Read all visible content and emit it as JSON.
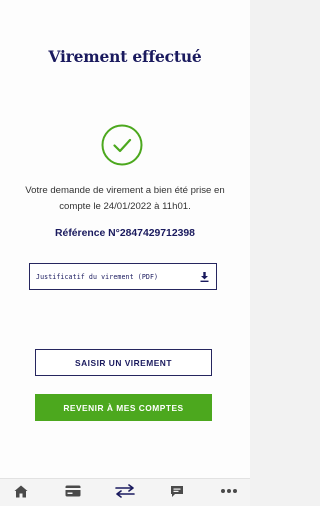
{
  "page": {
    "title": "Virement effectué",
    "message": "Votre demande de virement a bien été prise en compte le 24/01/2022 à 11h01.",
    "reference": "Référence N°2847429712398"
  },
  "download": {
    "label": "Justificatif du virement (PDF)",
    "icon": "download-icon"
  },
  "actions": {
    "new_transfer_label": "SAISIR UN VIREMENT",
    "back_to_accounts_label": "REVENIR À MES COMPTES"
  },
  "bottom_nav": {
    "items": [
      {
        "icon": "home-icon",
        "active": false
      },
      {
        "icon": "card-icon",
        "active": false
      },
      {
        "icon": "transfer-arrows-icon",
        "active": true
      },
      {
        "icon": "message-icon",
        "active": false
      },
      {
        "icon": "more-dots-icon",
        "active": false
      }
    ]
  },
  "colors": {
    "navy": "#1a1a5e",
    "success_green": "#4ca81e",
    "text_gray": "#333333"
  }
}
